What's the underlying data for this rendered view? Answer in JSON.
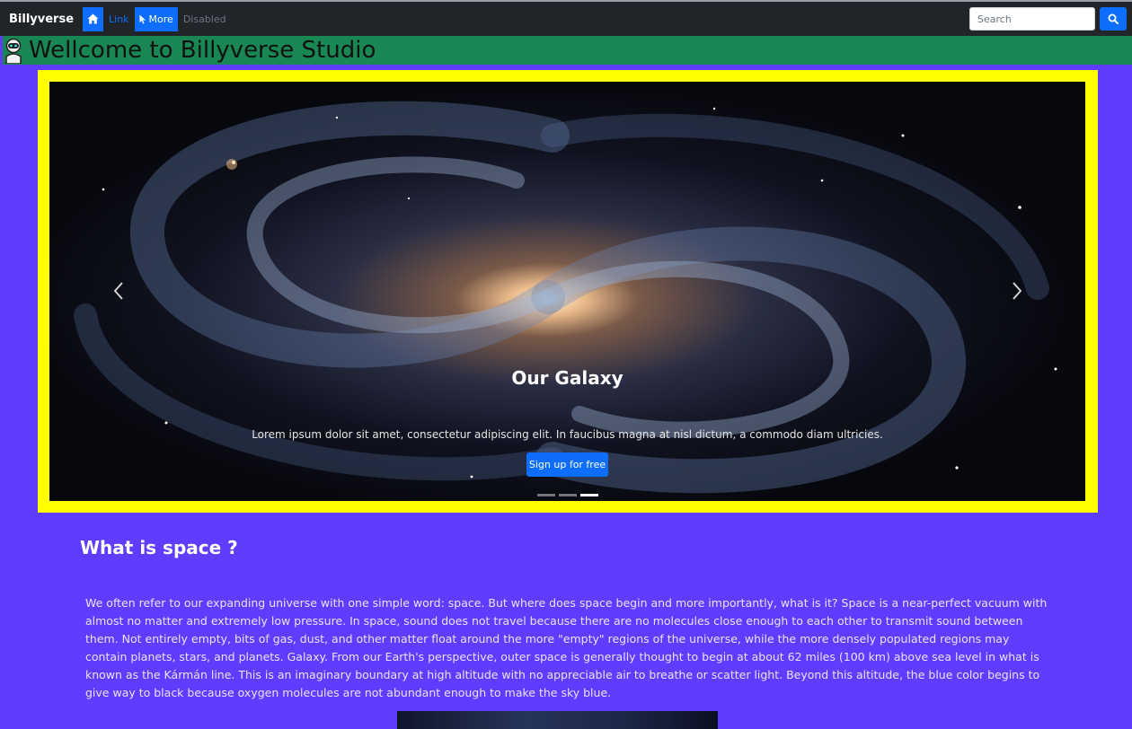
{
  "navbar": {
    "brand": "Billyverse",
    "link_label": "Link",
    "more_label": "More",
    "disabled_label": "Disabled",
    "search_placeholder": "Search"
  },
  "header": {
    "title": "Wellcome to Billyverse Studio"
  },
  "carousel": {
    "title": "Our Galaxy",
    "text": "Lorem ipsum dolor sit amet, consectetur adipiscing elit. In faucibus magna at nisl dictum, a commodo diam ultricies.",
    "button_label": "Sign up for free",
    "active_slide": 3,
    "slide_count": 3
  },
  "content": {
    "title": "What is space ?",
    "paragraph": "We often refer to our expanding universe with one simple word: space. But where does space begin and more importantly, what is it? Space is a near-perfect vacuum with almost no matter and extremely low pressure. In space, sound does not travel because there are no molecules close enough to each other to transmit sound between them. Not entirely empty, bits of gas, dust, and other matter float around the more \"empty\" regions of the universe, while the more densely populated regions may contain planets, stars, and planets. Galaxy. From our Earth's perspective, outer space is generally thought to begin at about 62 miles (100 km) above sea level in what is known as the Kármán line. This is an imaginary boundary at high altitude with no appreciable air to breathe or scatter light. Beyond this altitude, the blue color begins to give way to black because oxygen molecules are not abundant enough to make the sky blue."
  },
  "colors": {
    "page_bg": "#5f3cff",
    "navbar_bg": "#212529",
    "header_bg": "#198754",
    "carousel_border": "#ffff00",
    "accent": "#0d6efd"
  },
  "icons": {
    "home": "home-icon",
    "more": "cursor-icon",
    "search": "search-icon",
    "header": "robot-icon",
    "prev": "chevron-left-icon",
    "next": "chevron-right-icon"
  }
}
